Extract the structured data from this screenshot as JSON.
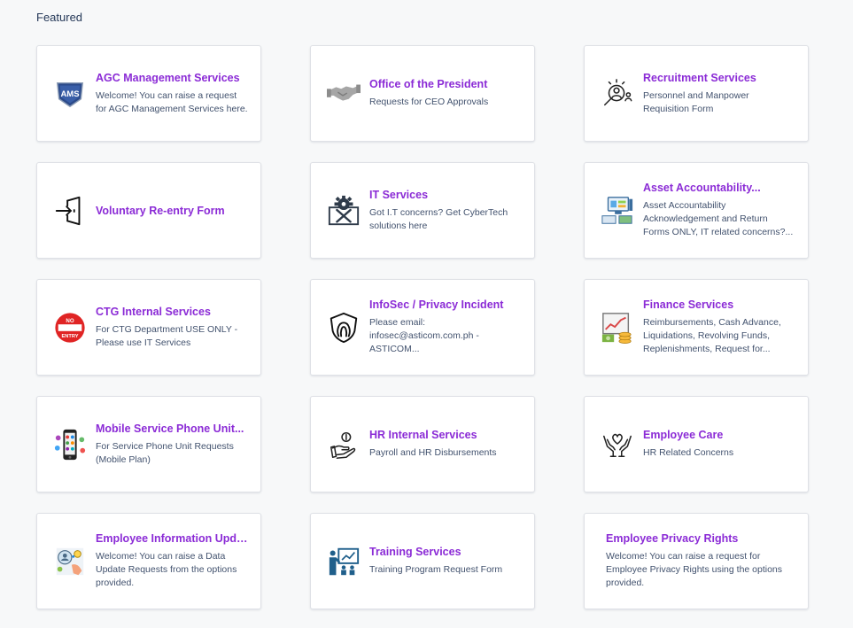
{
  "section": {
    "title": "Featured"
  },
  "accent_color": "#8b2bd6",
  "cards": [
    {
      "icon": "ams-shield-logo-icon",
      "title": "AGC Management Services",
      "description": "Welcome! You can raise a request for AGC Management Services here."
    },
    {
      "icon": "handshake-icon",
      "title": "Office of the President",
      "description": "Requests for CEO Approvals"
    },
    {
      "icon": "recruitment-magnifier-icon",
      "title": "Recruitment Services",
      "description": "Personnel and Manpower Requisition Form"
    },
    {
      "icon": "door-enter-icon",
      "title": "Voluntary Re-entry Form",
      "description": ""
    },
    {
      "icon": "gear-tools-icon",
      "title": "IT Services",
      "description": "Got I.T concerns? Get CyberTech solutions here"
    },
    {
      "icon": "computer-asset-icon",
      "title": "Asset Accountability...",
      "description": "Asset Accountability Acknowledgement and Return Forms ONLY, IT related concerns?..."
    },
    {
      "icon": "no-entry-sign-icon",
      "title": "CTG Internal Services",
      "description": "For CTG Department USE ONLY - Please use IT Services"
    },
    {
      "icon": "privacy-shield-icon",
      "title": "InfoSec / Privacy Incident",
      "description": "Please email: infosec@asticom.com.ph - ASTICOM..."
    },
    {
      "icon": "finance-chart-icon",
      "title": "Finance Services",
      "description": "Reimbursements, Cash Advance, Liquidations, Revolving Funds, Replenishments, Request for..."
    },
    {
      "icon": "mobile-phone-icon",
      "title": "Mobile Service Phone Unit...",
      "description": "For Service Phone Unit Requests (Mobile Plan)"
    },
    {
      "icon": "hand-money-icon",
      "title": "HR Internal Services",
      "description": "Payroll and HR Disbursements"
    },
    {
      "icon": "hands-heart-icon",
      "title": "Employee Care",
      "description": "HR Related Concerns"
    },
    {
      "icon": "info-update-icon",
      "title": "Employee Information Update",
      "description": "Welcome! You can raise a Data Update Requests from the options provided."
    },
    {
      "icon": "training-presentation-icon",
      "title": "Training Services",
      "description": "Training Program Request Form"
    },
    {
      "icon": "",
      "title": "Employee Privacy Rights",
      "description": "Welcome! You can raise a request for Employee Privacy Rights using the options provided."
    }
  ]
}
